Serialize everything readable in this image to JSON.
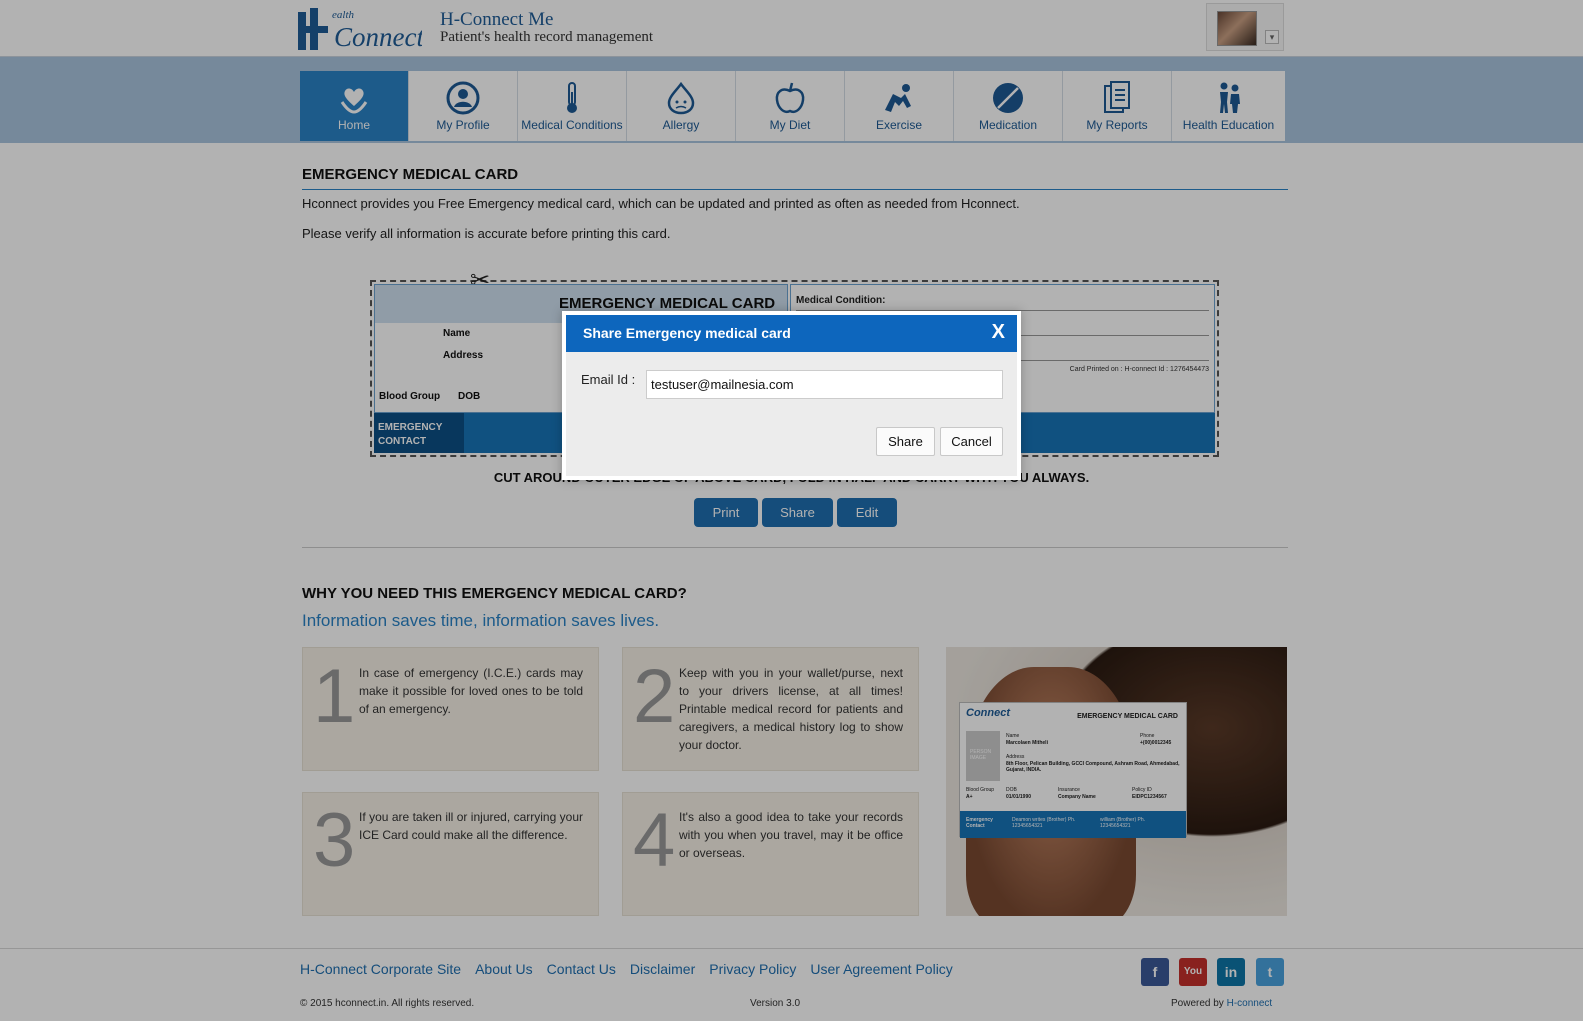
{
  "header": {
    "brand_title": "H-Connect Me",
    "brand_subtitle": "Patient's health record management",
    "logo_text_top": "ealth",
    "logo_text_main": "Connect"
  },
  "nav": {
    "items": [
      {
        "label": "Home",
        "icon": "heart-hands-icon"
      },
      {
        "label": "My Profile",
        "icon": "profile-icon"
      },
      {
        "label": "Medical Conditions",
        "icon": "thermometer-icon"
      },
      {
        "label": "Allergy",
        "icon": "allergy-icon"
      },
      {
        "label": "My Diet",
        "icon": "apple-icon"
      },
      {
        "label": "Exercise",
        "icon": "exercise-icon"
      },
      {
        "label": "Medication",
        "icon": "pill-icon"
      },
      {
        "label": "My Reports",
        "icon": "reports-icon"
      },
      {
        "label": "Health Education",
        "icon": "education-icon"
      }
    ],
    "active": "Home"
  },
  "main": {
    "section_title": "EMERGENCY MEDICAL CARD",
    "intro_1": "Hconnect provides you Free Emergency medical card, which can be updated and printed as often as needed from Hconnect.",
    "intro_2": "Please verify all information is accurate before printing this card.",
    "card": {
      "title": "EMERGENCY MEDICAL CARD",
      "name_label": "Name",
      "address_label": "Address",
      "blood_group_label": "Blood Group",
      "dob_label": "DOB",
      "medical_condition_label": "Medical Condition:",
      "printed_on": "Card Printed on :  H-connect Id : 1276454473",
      "emergency_contact_line1": "EMERGENCY",
      "emergency_contact_line2": "CONTACT"
    },
    "cut_text": "CUT AROUND OUTER EDGE OF ABOVE CARD, FOLD IN HALF AND CARRY WITH YOU ALWAYS.",
    "buttons": {
      "print": "Print",
      "share": "Share",
      "edit": "Edit"
    },
    "why_title": "WHY YOU NEED THIS EMERGENCY MEDICAL CARD?",
    "why_subtitle": "Information saves time, information saves lives.",
    "tiles": [
      {
        "number": "1",
        "text": "In case of emergency (I.C.E.) cards may make it possible for loved ones to be told of an emergency."
      },
      {
        "number": "2",
        "text": "Keep with you in your wallet/purse, next to your drivers license, at all times! Printable medical record for patients and caregivers, a medical history log to show your doctor."
      },
      {
        "number": "3",
        "text": "If you are taken ill or injured, carrying your ICE Card could make all the difference."
      },
      {
        "number": "4",
        "text": "It's also a good idea to take your records with you when you travel, may it be office or overseas."
      }
    ],
    "photo_card": {
      "title": "EMERGENCY MEDICAL CARD",
      "name_label": "Name",
      "name_value": "Marcolaen Mitheli",
      "phone_label": "Phone",
      "phone_value": "+(00)0012345",
      "address_label": "Address",
      "address_value": "8th Floor, Pelican Building, GCCI Compound, Ashram Road, Ahmedabad, Gujarat, INDIA.",
      "image_label": "PERSON IMAGE",
      "blood_group_label": "Blood Group",
      "blood_group_value": "A+",
      "dob_label": "DOB",
      "dob_value": "01/01/1990",
      "insurance_label": "Insurance",
      "insurance_value": "Company Name",
      "policy_label": "Policy ID",
      "policy_value": "EIDPC1234567",
      "ec_label": "Emergency Contact",
      "contact1": "Deamon writes (Brother) Ph. 12345654321",
      "contact2": "william (Brother) Ph. 12345654321"
    }
  },
  "footer": {
    "links": [
      "H-Connect Corporate Site",
      "About Us",
      "Contact Us",
      "Disclaimer",
      "Privacy Policy",
      "User Agreement Policy"
    ],
    "copyright": "© 2015 hconnect.in. All rights reserved.",
    "version": "Version 3.0",
    "powered_prefix": "Powered by",
    "powered_brand": "H-connect",
    "social": [
      {
        "name": "facebook-icon",
        "glyph": "f",
        "color": "#3b5998"
      },
      {
        "name": "youtube-icon",
        "glyph": "You",
        "color": "#c4302b"
      },
      {
        "name": "linkedin-icon",
        "glyph": "in",
        "color": "#0e76a8"
      },
      {
        "name": "twitter-icon",
        "glyph": "t",
        "color": "#4aa3df"
      }
    ]
  },
  "modal": {
    "title": "Share Emergency medical card",
    "close": "X",
    "email_label": "Email Id :",
    "email_value": "testuser@mailnesia.com",
    "share_button": "Share",
    "cancel_button": "Cancel"
  }
}
